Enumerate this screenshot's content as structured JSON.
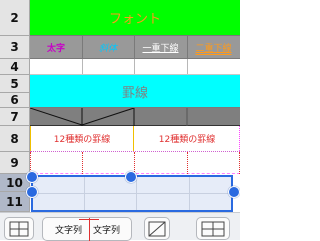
{
  "rows": [
    "2",
    "3",
    "4",
    "5",
    "6",
    "7",
    "8",
    "9",
    "10",
    "11"
  ],
  "sheet": {
    "font_title": "フォント",
    "font_samples": {
      "bold": "太字",
      "italic": "斜体",
      "single_underline": "一重下線",
      "double_underline": "二重下線"
    },
    "border_title": "罫線",
    "border_label_left": "12種類の罫線",
    "border_label_right": "12種類の罫線"
  },
  "toolbar": {
    "sample_left": "文字列",
    "sample_right": "文字列"
  },
  "colors": {
    "green": "#00ff00",
    "cyan": "#00ffff",
    "gray": "#999999",
    "dark_gray": "#7f7f7f",
    "selection": "#2a6ae0"
  }
}
